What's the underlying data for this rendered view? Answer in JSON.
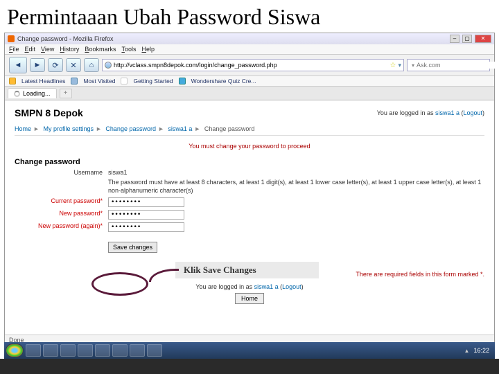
{
  "slide": {
    "title": "Permintaaan Ubah Password Siswa"
  },
  "window": {
    "title": "Change password - Mozilla Firefox",
    "menus": [
      "File",
      "Edit",
      "View",
      "History",
      "Bookmarks",
      "Tools",
      "Help"
    ],
    "url": "http://vclass.smpn8depok.com/login/change_password.php",
    "search_placeholder": "Ask.com",
    "bookmarks": [
      "Latest Headlines",
      "Most Visited",
      "Getting Started",
      "Wondershare Quiz Cre..."
    ],
    "tab_label": "Loading...",
    "status": "Done"
  },
  "page": {
    "site_name": "SMPN 8 Depok",
    "login_text_prefix": "You are logged in as ",
    "login_user": "siswa1 a",
    "login_logout": "Logout",
    "breadcrumb": [
      "Home",
      "My profile settings",
      "Change password",
      "siswa1 a",
      "Change password"
    ],
    "notice": "You must change your password to proceed",
    "form_title": "Change password",
    "username_label": "Username",
    "username_value": "siswa1",
    "help": "The password must have at least 8 characters, at least 1 digit(s), at least 1 lower case letter(s), at least 1 upper case letter(s), at least 1 non-alphanumeric character(s)",
    "current_pw_label": "Current password*",
    "new_pw_label": "New password*",
    "new_pw_again_label": "New password (again)*",
    "pw_mask": "••••••••",
    "save_button": "Save changes",
    "required_note": "There are required fields in this form marked *.",
    "home_button": "Home"
  },
  "callout": {
    "text": "Klik Save Changes"
  },
  "taskbar": {
    "clock": "16:22"
  }
}
